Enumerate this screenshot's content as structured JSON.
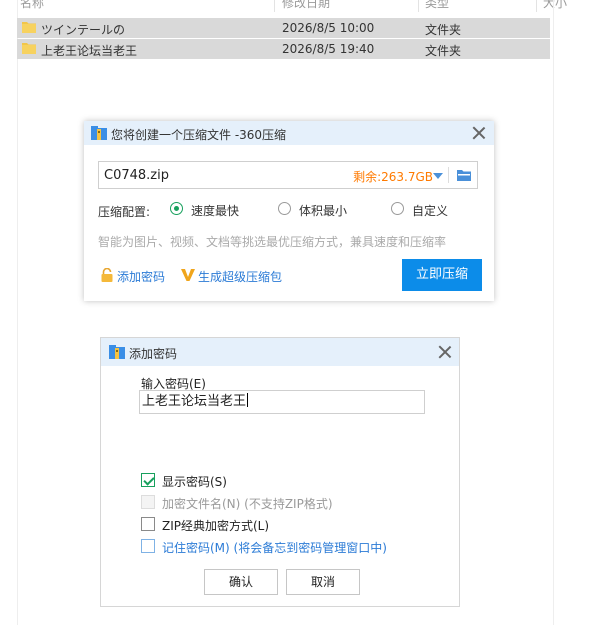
{
  "explorer": {
    "columns": [
      "名称",
      "修改日期",
      "类型",
      "大小"
    ],
    "files": [
      {
        "name": "ツインテールの",
        "date": "2026/8/5 10:00",
        "type": "文件夹"
      },
      {
        "name": "上老王论坛当老王",
        "date": "2026/8/5 19:40",
        "type": "文件夹"
      }
    ]
  },
  "compress_dialog": {
    "title": "您将创建一个压缩文件 -360压缩",
    "filename": "C0748.zip",
    "free_space": "剩余:263.7GB",
    "config_label": "压缩配置:",
    "options": [
      "速度最快",
      "体积最小",
      "自定义"
    ],
    "selected_option": "速度最快",
    "hint": "智能为图片、视频、文档等挑选最优压缩方式，兼具速度和压缩率",
    "add_password": "添加密码",
    "super_package": "生成超级压缩包",
    "compress_now": "立即压缩"
  },
  "password_dialog": {
    "title": "添加密码",
    "input_label": "输入密码(E)",
    "password_value": "上老王论坛当老王",
    "show_password": "显示密码(S)",
    "encrypt_filenames": "加密文件名(N) (不支持ZIP格式)",
    "zip_classic": "ZIP经典加密方式(L)",
    "remember_password": "记住密码(M) (将会备忘到密码管理窗口中)",
    "ok": "确认",
    "cancel": "取消"
  },
  "colors": {
    "accent_blue": "#0c8ce9",
    "green": "#17a05d",
    "orange": "#ff7a00",
    "link_blue": "#2b7bd6",
    "title_bar": "#e5f0fb"
  }
}
